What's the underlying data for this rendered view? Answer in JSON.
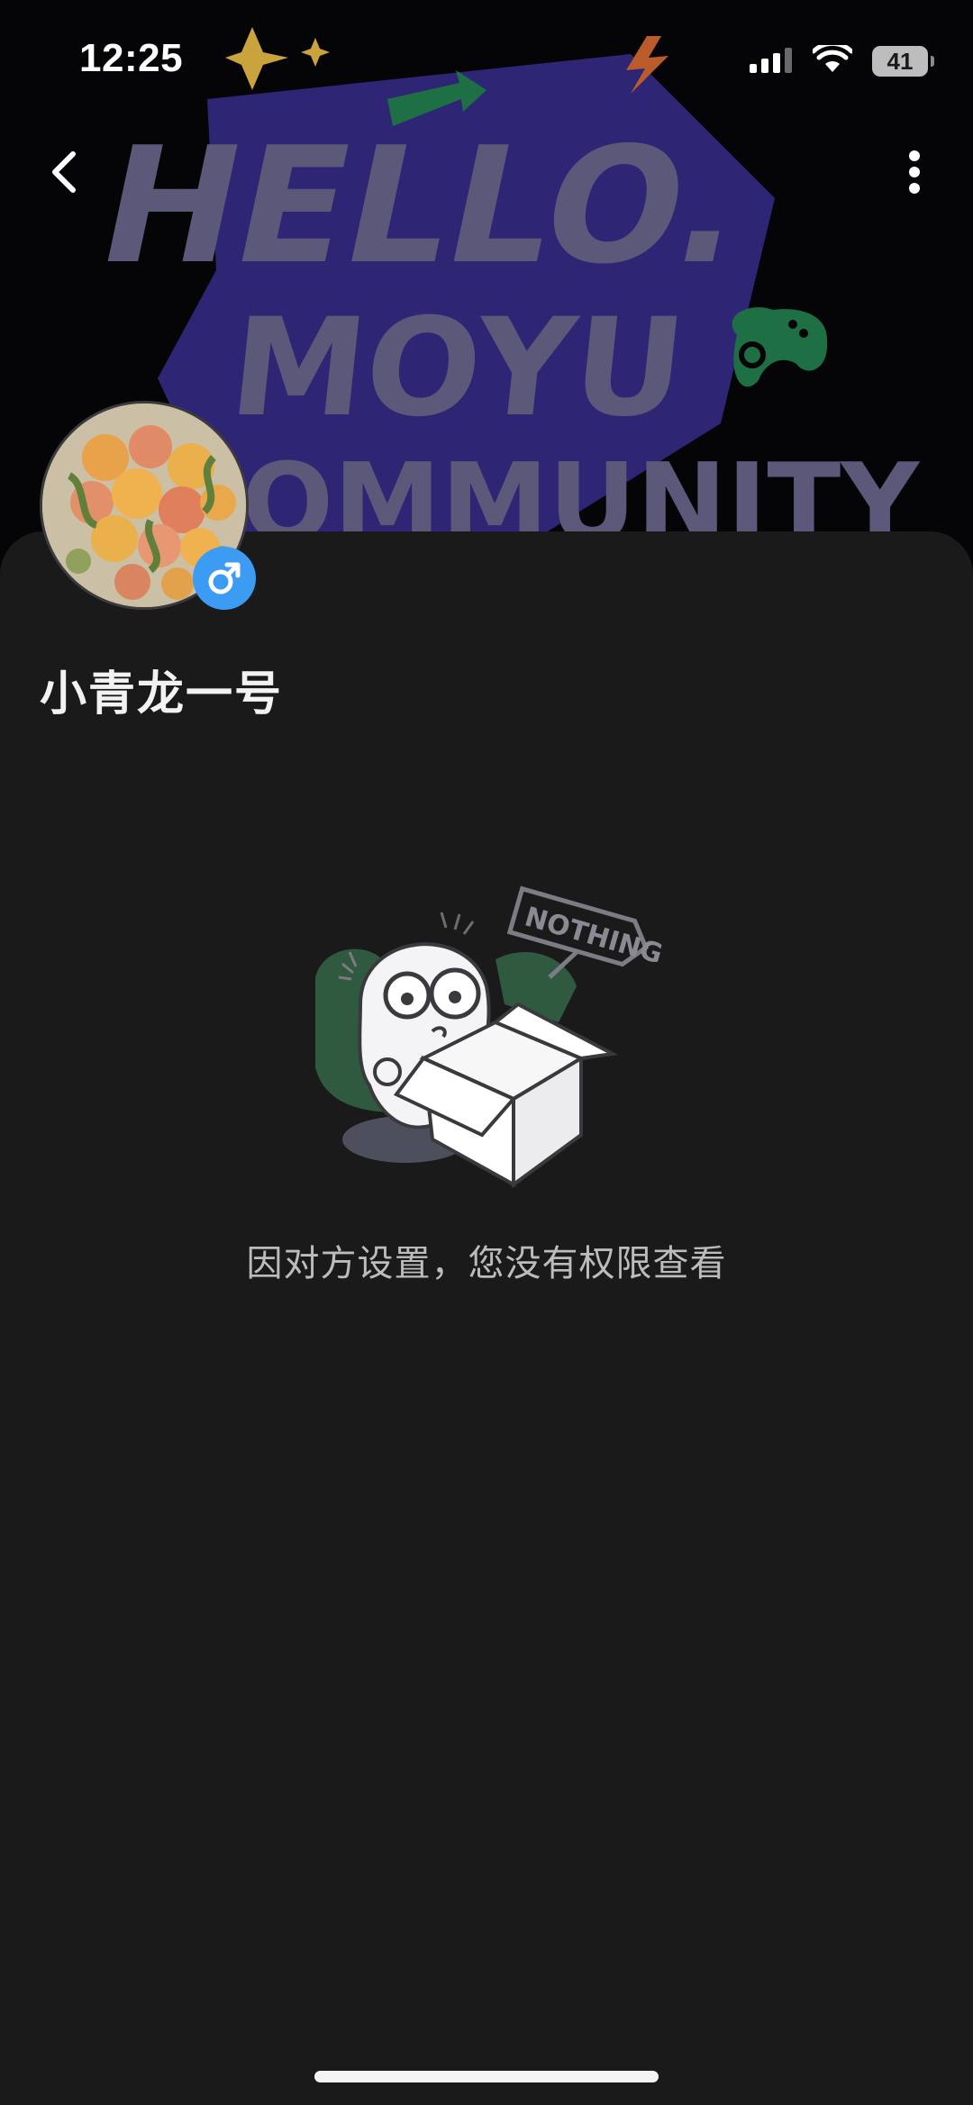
{
  "status_bar": {
    "time": "12:25",
    "battery_level": "41"
  },
  "banner": {
    "line1": "HELLO.",
    "line2": "MOYU",
    "line3": "COMMUNITY"
  },
  "profile": {
    "username": "小青龙一号",
    "gender_symbol": "♂"
  },
  "empty_state": {
    "badge_text": "NOTHING",
    "message": "因对方设置，您没有权限查看"
  },
  "colors": {
    "background": "#1a1a1b",
    "banner_purple": "#2e2675",
    "banner_text": "#5b5879",
    "gender_badge": "#3c9bf3",
    "message_text": "#bcbcbc"
  }
}
